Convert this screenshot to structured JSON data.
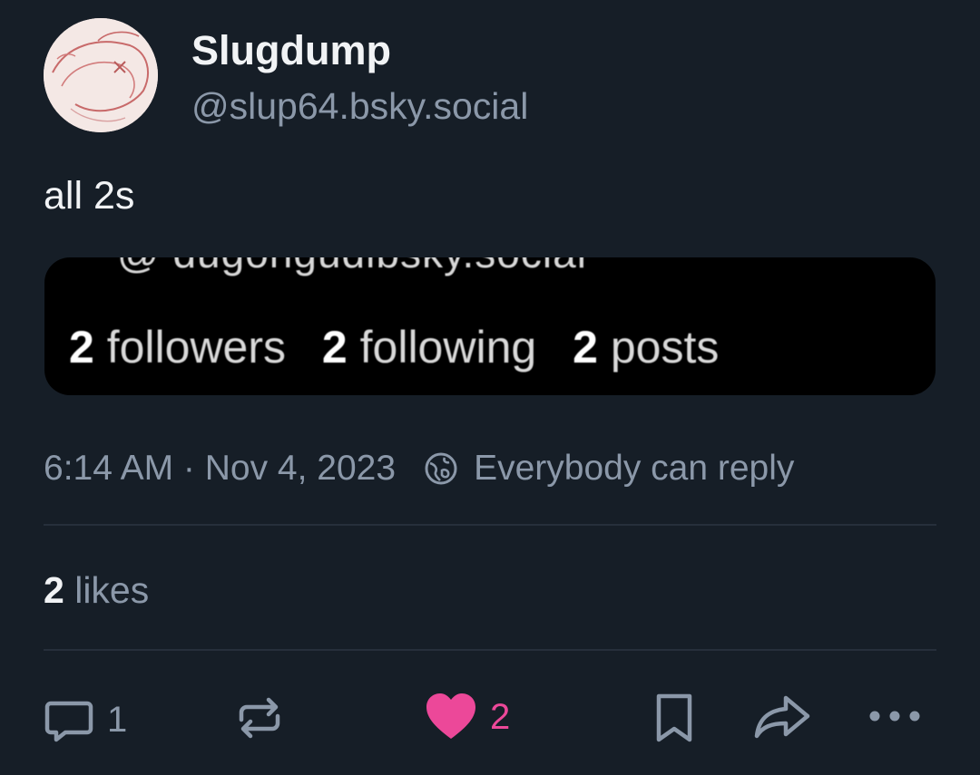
{
  "author": {
    "display_name": "Slugdump",
    "handle": "@slup64.bsky.social"
  },
  "post": {
    "text": "all 2s",
    "timestamp": "6:14 AM · Nov 4, 2023",
    "reply_setting": "Everybody can reply"
  },
  "embed_image": {
    "cropped_handle": "@ dugongudibsky.social",
    "stats": [
      {
        "count": "2",
        "label": "followers"
      },
      {
        "count": "2",
        "label": "following"
      },
      {
        "count": "2",
        "label": "posts"
      }
    ]
  },
  "engagement": {
    "likes_count": "2",
    "likes_label": "likes"
  },
  "actions": {
    "reply_count": "1",
    "like_count": "2",
    "like_active": true
  },
  "icons": {
    "reply": "speech-bubble-icon",
    "repost": "repost-icon",
    "like": "heart-icon",
    "bookmark": "bookmark-icon",
    "share": "share-arrow-icon",
    "more": "more-dots-icon",
    "reply_setting": "globe-icon"
  },
  "colors": {
    "background": "#161e27",
    "primary_text": "#f1f3f5",
    "secondary_text": "#8b98a9",
    "like_accent": "#ec4899",
    "divider": "#262f3b"
  }
}
